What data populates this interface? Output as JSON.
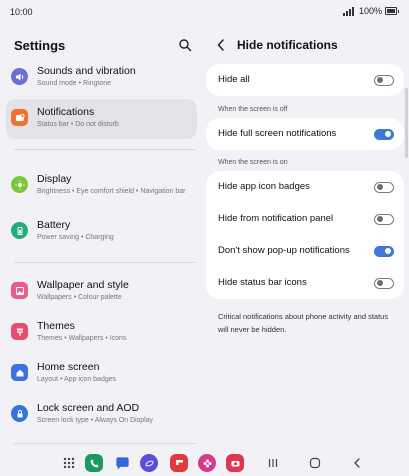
{
  "status_bar": {
    "time": "10:00",
    "battery": "100%"
  },
  "left": {
    "title": "Settings",
    "items": [
      {
        "label": "Sounds and vibration",
        "sub": "Sound mode  •  Ringtone",
        "icon": "volume-icon",
        "color": "#6b6fd6"
      },
      {
        "label": "Notifications",
        "sub": "Status bar  •  Do not disturb",
        "icon": "notification-icon",
        "color": "#f07130"
      },
      {
        "label": "Display",
        "sub": "Brightness  •  Eye comfort shield  •  Navigation bar",
        "icon": "sun-icon",
        "color": "#7cc63a"
      },
      {
        "label": "Battery",
        "sub": "Power saving  •  Charging",
        "icon": "battery-icon",
        "color": "#23ad7d"
      },
      {
        "label": "Wallpaper and style",
        "sub": "Wallpapers  •  Colour palette",
        "icon": "wallpaper-icon",
        "color": "#e65f8a"
      },
      {
        "label": "Themes",
        "sub": "Themes  •  Wallpapers  •  Icons",
        "icon": "themes-icon",
        "color": "#e84c6f"
      },
      {
        "label": "Home screen",
        "sub": "Layout  •  App icon badges",
        "icon": "home-icon",
        "color": "#3f6fe0"
      },
      {
        "label": "Lock screen and AOD",
        "sub": "Screen lock type  •  Always On Display",
        "icon": "lock-icon",
        "color": "#3173df"
      }
    ]
  },
  "right": {
    "title": "Hide notifications",
    "hide_all": {
      "label": "Hide all",
      "on": false
    },
    "section_off": "When the screen is off",
    "hide_full": {
      "label": "Hide full screen notifications",
      "on": true
    },
    "section_on": "When the screen is on",
    "on_items": [
      {
        "label": "Hide app icon badges",
        "on": false
      },
      {
        "label": "Hide from notification panel",
        "on": false
      },
      {
        "label": "Don't show pop-up notifications",
        "on": true
      },
      {
        "label": "Hide status bar icons",
        "on": false
      }
    ],
    "footnote": "Critical notifications about phone activity and status will never be hidden."
  },
  "dock": [
    {
      "icon": "apps-grid-icon"
    },
    {
      "icon": "phone-icon",
      "color": "#1d9a5f"
    },
    {
      "icon": "messages-icon",
      "color": "#2f6ad6"
    },
    {
      "icon": "internet-icon",
      "color": "#5b4ed8"
    },
    {
      "icon": "flipboard-icon",
      "color": "#e23a3a"
    },
    {
      "icon": "gallery-icon",
      "color": "#d63a8c"
    },
    {
      "icon": "camera-icon",
      "color": "#e0344f"
    }
  ],
  "colors": {
    "accent": "#3e78d8",
    "background": "#f2f2f6",
    "active_item": "#e2e2e8"
  }
}
